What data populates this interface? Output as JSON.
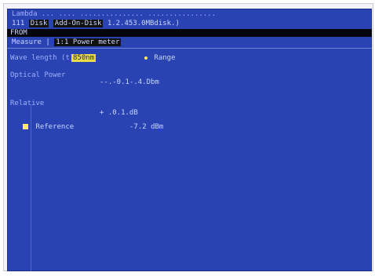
{
  "header": {
    "line1": "Lambda ...          ....          ...............   ................",
    "line2_prefix": "111",
    "line2_tab1": "Disk",
    "line2_tab2": "Add-On-Disk",
    "line2_tab3": "1.2.453.0MBdisk.)",
    "line3": "FROM",
    "line4_prefix": "Measure",
    "line4_sep": "|",
    "line4_box": "1:1 Power meter"
  },
  "fields": {
    "wave_length_label": "Wave length (t)",
    "wave_length_value": "850nm",
    "range_value": "Range",
    "optical_power_label": "Optical Power",
    "optical_power_value": "--.-0.1-.4.Dbm",
    "relative_label": "Relative",
    "relative_value": "+ .0.1.dB",
    "reference_label": "Reference",
    "reference_value": "-7.2 dBm"
  }
}
